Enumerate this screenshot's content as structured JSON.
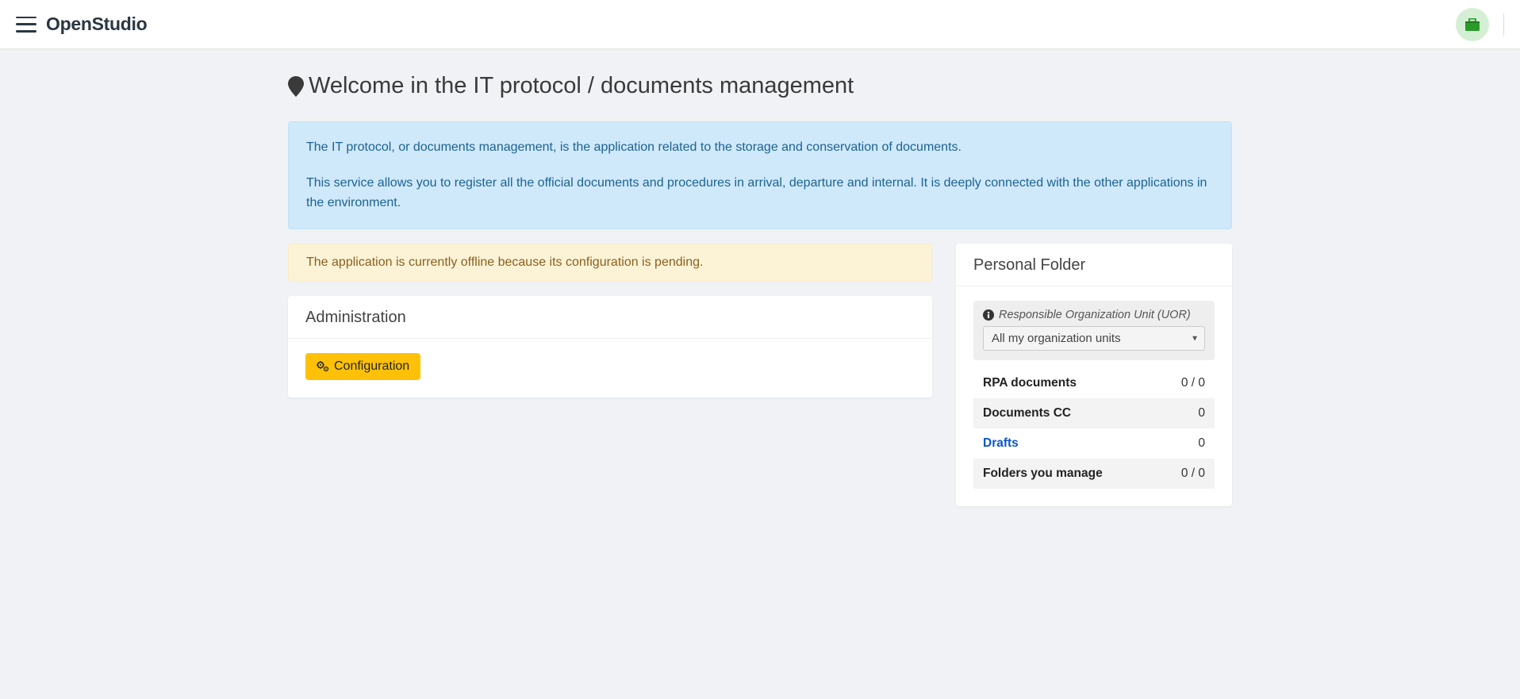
{
  "header": {
    "brand": "OpenStudio"
  },
  "page": {
    "title": "Welcome in the IT protocol / documents management",
    "info_p1": "The IT protocol, or documents management, is the application related to the storage and conservation of documents.",
    "info_p2": "This service allows you to register all the official documents and procedures in arrival, departure and internal. It is deeply connected with the other applications in the environment.",
    "warning": "The application is currently offline because its configuration is pending."
  },
  "admin": {
    "title": "Administration",
    "config_button": "Configuration"
  },
  "sidebar": {
    "title": "Personal Folder",
    "uor_label": "Responsible Organization Unit (UOR)",
    "uor_selected": "All my organization units",
    "items": [
      {
        "label": "RPA documents",
        "value": "0 / 0",
        "link": false
      },
      {
        "label": "Documents CC",
        "value": "0",
        "link": false
      },
      {
        "label": "Drafts",
        "value": "0",
        "link": true
      },
      {
        "label": "Folders you manage",
        "value": "0 / 0",
        "link": false
      }
    ]
  }
}
